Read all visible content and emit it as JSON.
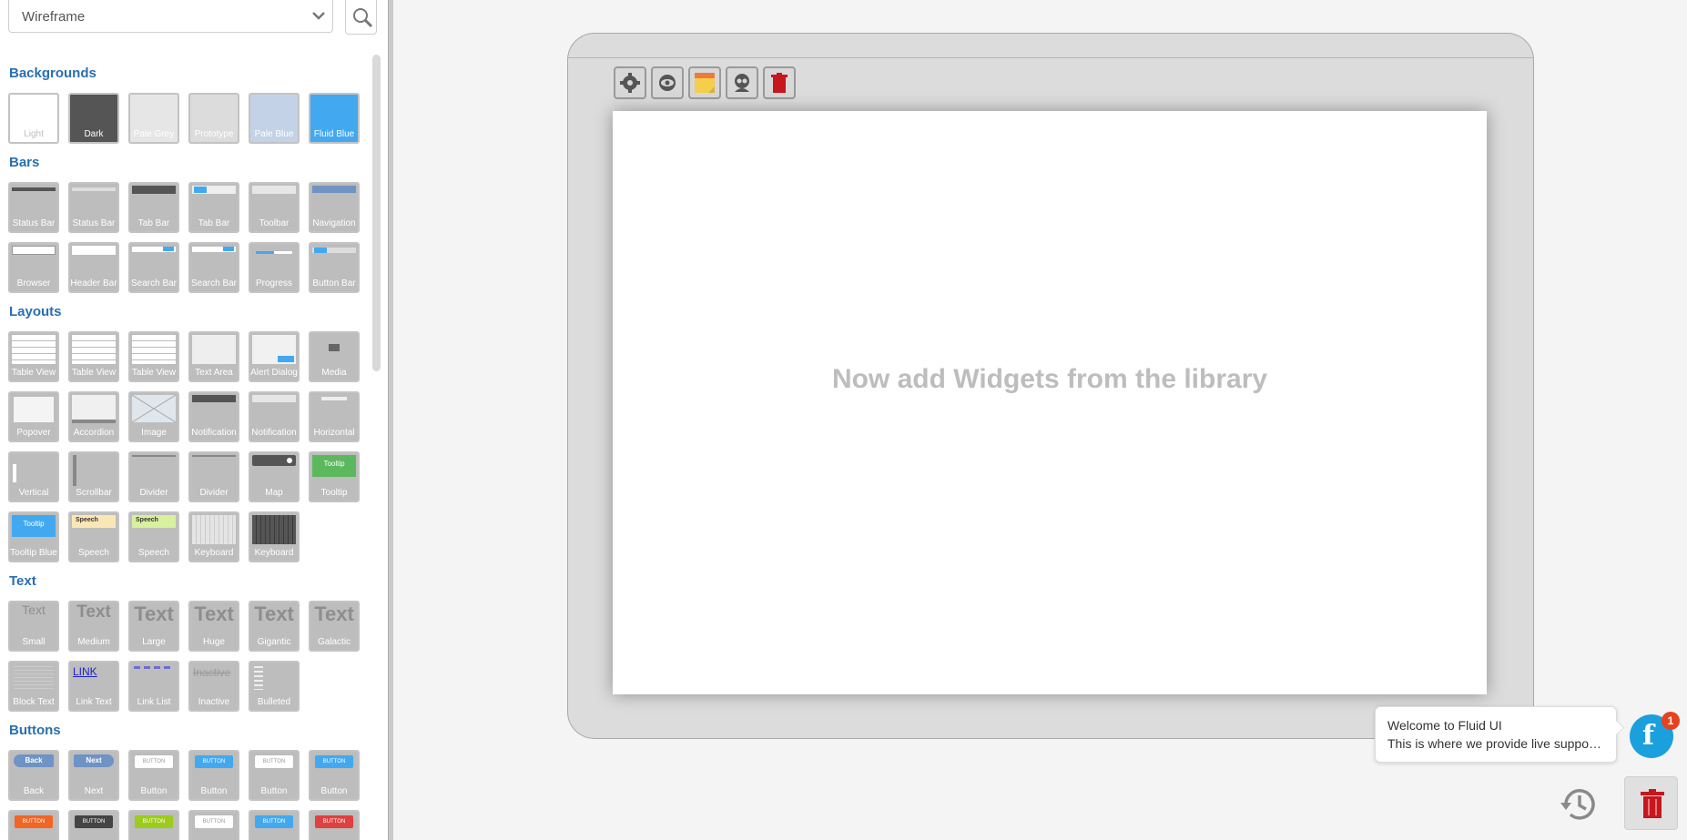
{
  "library": {
    "selected": "Wireframe"
  },
  "canvas": {
    "message": "Now add Widgets from the library"
  },
  "chat": {
    "title": "Welcome to Fluid UI",
    "message": "This is where we provide live suppo…",
    "badge": "1",
    "logo": "f"
  },
  "sections": [
    {
      "title": "Backgrounds",
      "tiles": [
        {
          "label": "Light",
          "bg": "#ffffff",
          "fg": "#bdbdbd"
        },
        {
          "label": "Dark",
          "bg": "#555555",
          "fg": "#ffffff"
        },
        {
          "label": "Pale Grey",
          "bg": "#e6e6e6",
          "fg": "#ffffff"
        },
        {
          "label": "Prototype",
          "bg": "#dcdcdc",
          "fg": "#ffffff"
        },
        {
          "label": "Pale Blue",
          "bg": "#c3d2e6",
          "fg": "#ffffff"
        },
        {
          "label": "Fluid Blue",
          "bg": "#42a9f0",
          "fg": "#ffffff"
        }
      ]
    },
    {
      "title": "Bars",
      "tiles": [
        {
          "label": "Status Bar",
          "kind": "bar-top"
        },
        {
          "label": "Status Bar",
          "kind": "bar-top-light"
        },
        {
          "label": "Tab Bar",
          "kind": "tabbar-dark"
        },
        {
          "label": "Tab Bar",
          "kind": "tabbar-blue"
        },
        {
          "label": "Toolbar",
          "kind": "toolbar"
        },
        {
          "label": "Navigation",
          "kind": "nav"
        },
        {
          "label": "Browser",
          "kind": "browser"
        },
        {
          "label": "Header Bar",
          "kind": "header"
        },
        {
          "label": "Search Bar",
          "kind": "search"
        },
        {
          "label": "Search Bar",
          "kind": "search"
        },
        {
          "label": "Progress",
          "kind": "progress"
        },
        {
          "label": "Button Bar",
          "kind": "buttonbar"
        }
      ]
    },
    {
      "title": "Layouts",
      "tiles": [
        {
          "label": "Table View",
          "kind": "table"
        },
        {
          "label": "Table View",
          "kind": "table"
        },
        {
          "label": "Table View",
          "kind": "table"
        },
        {
          "label": "Text Area",
          "kind": "textarea"
        },
        {
          "label": "Alert Dialog",
          "kind": "alert"
        },
        {
          "label": "Media",
          "kind": "media"
        },
        {
          "label": "Popover",
          "kind": "popover"
        },
        {
          "label": "Accordion",
          "kind": "accordion"
        },
        {
          "label": "Image",
          "kind": "image"
        },
        {
          "label": "Notification",
          "kind": "notif-dark"
        },
        {
          "label": "Notification",
          "kind": "notif-light"
        },
        {
          "label": "Horizontal",
          "kind": "horizontal"
        },
        {
          "label": "Vertical",
          "kind": "vertical"
        },
        {
          "label": "Scrollbar",
          "kind": "scrollbar"
        },
        {
          "label": "Divider",
          "kind": "divider"
        },
        {
          "label": "Divider",
          "kind": "divider"
        },
        {
          "label": "Map",
          "kind": "map"
        },
        {
          "label": "Tooltip",
          "kind": "tooltip-green",
          "text": "Tooltip"
        },
        {
          "label": "Tooltip Blue",
          "kind": "tooltip-blue",
          "text": "Tooltip"
        },
        {
          "label": "Speech",
          "kind": "speech-yellow",
          "text": "Speech"
        },
        {
          "label": "Speech",
          "kind": "speech-green",
          "text": "Speech"
        },
        {
          "label": "Keyboard",
          "kind": "keyboard-light"
        },
        {
          "label": "Keyboard",
          "kind": "keyboard-dark"
        }
      ]
    },
    {
      "title": "Text",
      "tiles": [
        {
          "label": "Small",
          "kind": "text",
          "text": "Text",
          "size": 14
        },
        {
          "label": "Medium",
          "kind": "text",
          "text": "Text",
          "size": 19
        },
        {
          "label": "Large",
          "kind": "text",
          "text": "Text",
          "size": 22
        },
        {
          "label": "Huge",
          "kind": "text",
          "text": "Text",
          "size": 22
        },
        {
          "label": "Gigantic",
          "kind": "text",
          "text": "Text",
          "size": 22
        },
        {
          "label": "Galactic",
          "kind": "text",
          "text": "Text",
          "size": 22
        },
        {
          "label": "Block Text",
          "kind": "blocktext"
        },
        {
          "label": "Link Text",
          "kind": "link",
          "text": "LINK"
        },
        {
          "label": "Link List",
          "kind": "linklist"
        },
        {
          "label": "Inactive",
          "kind": "inactive",
          "text": "Inactive"
        },
        {
          "label": "Bulleted",
          "kind": "bulleted"
        }
      ]
    },
    {
      "title": "Buttons",
      "tiles": [
        {
          "label": "Back",
          "kind": "btn-back",
          "text": "Back"
        },
        {
          "label": "Next",
          "kind": "btn-next",
          "text": "Next"
        },
        {
          "label": "Button",
          "kind": "btn",
          "text": "BUTTON",
          "color": "#ffffff",
          "tc": "#999999"
        },
        {
          "label": "Button",
          "kind": "btn",
          "text": "BUTTON",
          "color": "#42a9f0",
          "tc": "#ffffff"
        },
        {
          "label": "Button",
          "kind": "btn",
          "text": "BUTTON",
          "color": "#ffffff",
          "tc": "#999999"
        },
        {
          "label": "Button",
          "kind": "btn",
          "text": "BUTTON",
          "color": "#42a9f0",
          "tc": "#ffffff"
        },
        {
          "label": "",
          "kind": "btn",
          "text": "BUTTON",
          "color": "#f26522",
          "tc": "#ffffff"
        },
        {
          "label": "",
          "kind": "btn",
          "text": "BUTTON",
          "color": "#444444",
          "tc": "#ffffff"
        },
        {
          "label": "",
          "kind": "btn",
          "text": "BUTTON",
          "color": "#9ccc1c",
          "tc": "#ffffff"
        },
        {
          "label": "",
          "kind": "btn",
          "text": "BUTTON",
          "color": "#ffffff",
          "tc": "#999999"
        },
        {
          "label": "",
          "kind": "btn",
          "text": "BUTTON",
          "color": "#42a9f0",
          "tc": "#ffffff"
        },
        {
          "label": "",
          "kind": "btn",
          "text": "BUTTON",
          "color": "#e04040",
          "tc": "#ffffff"
        }
      ]
    }
  ],
  "tools": [
    {
      "name": "screen-settings-icon"
    },
    {
      "name": "preview-eye-icon"
    },
    {
      "name": "sticky-note-icon"
    },
    {
      "name": "user-share-icon"
    },
    {
      "name": "delete-trash-icon"
    }
  ],
  "icons": {
    "history": "history-clock-icon",
    "trash": "trash-icon",
    "search": "search-icon",
    "dropdown": "chevron-down-icon"
  }
}
